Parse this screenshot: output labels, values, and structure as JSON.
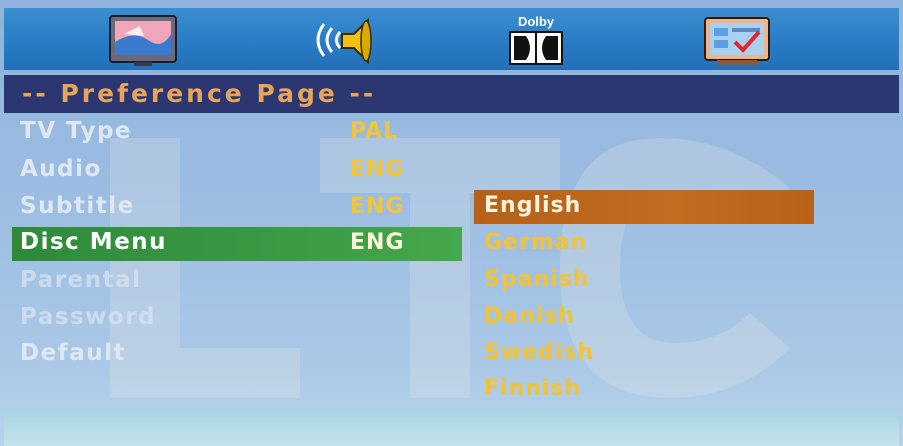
{
  "tabs": [
    {
      "name": "tv-settings-icon",
      "label": ""
    },
    {
      "name": "audio-speaker-icon",
      "label": ""
    },
    {
      "name": "dolby-icon",
      "label": "Dolby"
    },
    {
      "name": "preference-checklist-icon",
      "label": ""
    }
  ],
  "header": {
    "title": "-- Preference Page --"
  },
  "watermark": {
    "text": "LTC"
  },
  "menu": {
    "items": [
      {
        "label": "TV Type",
        "value": "PAL"
      },
      {
        "label": "Audio",
        "value": "ENG"
      },
      {
        "label": "Subtitle",
        "value": "ENG"
      },
      {
        "label": "Disc Menu",
        "value": "ENG",
        "selected": true
      },
      {
        "label": "Parental",
        "value": ""
      },
      {
        "label": "Password",
        "value": ""
      },
      {
        "label": "Default",
        "value": ""
      }
    ]
  },
  "options": {
    "items": [
      {
        "label": "English",
        "selected": true
      },
      {
        "label": "German"
      },
      {
        "label": "Spanish"
      },
      {
        "label": "Danish"
      },
      {
        "label": "Swedish"
      },
      {
        "label": "Finnish"
      }
    ]
  },
  "colors": {
    "header_bg": "#2c3670",
    "header_text": "#e6a55a",
    "selected_row": "#3b9a44",
    "selected_option": "#c26c1e",
    "value_text": "#f1c63a"
  }
}
